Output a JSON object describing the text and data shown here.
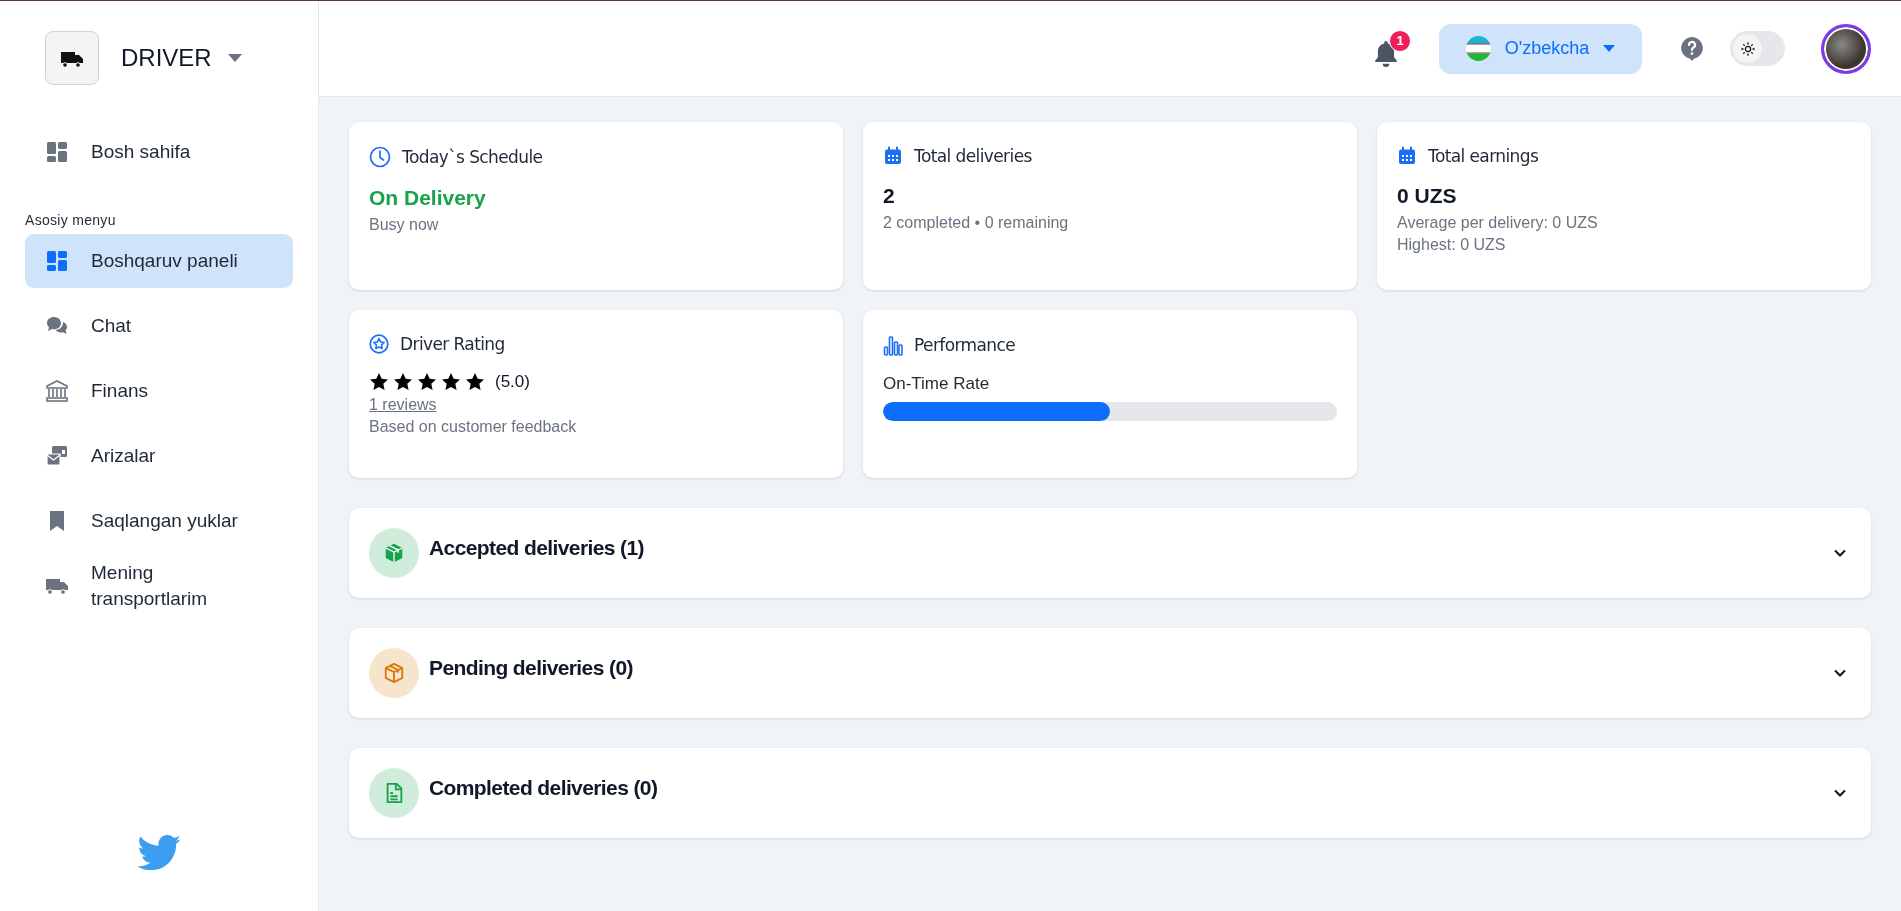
{
  "sidebar": {
    "brand": "DRIVER",
    "home": {
      "label": "Bosh sahifa",
      "selected": false
    },
    "section_label": "Asosiy menyu",
    "items": [
      {
        "kind": "dashboard",
        "label": "Boshqaruv paneli",
        "selected": true
      },
      {
        "kind": "chat",
        "label": "Chat",
        "selected": false
      },
      {
        "kind": "bank",
        "label": "Finans",
        "selected": false
      },
      {
        "kind": "mail",
        "label": "Arizalar",
        "selected": false
      },
      {
        "kind": "bookmark",
        "label": "Saqlangan yuklar",
        "selected": false
      },
      {
        "kind": "truck",
        "label": "Mening transportlarim",
        "selected": false
      }
    ]
  },
  "header": {
    "notification_count": "1",
    "language": "O'zbekcha",
    "theme_toggle": {
      "on": false
    }
  },
  "cards": {
    "schedule": {
      "title": "Today`s Schedule",
      "status": "On Delivery",
      "note": "Busy now"
    },
    "deliveries": {
      "title": "Total deliveries",
      "value": "2",
      "summary": "2 completed • 0 remaining"
    },
    "earnings": {
      "title": "Total earnings",
      "value": "0 UZS",
      "average": "Average per delivery: 0 UZS",
      "highest": "Highest: 0 UZS"
    },
    "rating": {
      "title": "Driver Rating",
      "stars": 5,
      "score": "(5.0)",
      "reviews_link": "1 reviews",
      "note": "Based on customer feedback"
    },
    "performance": {
      "title": "Performance",
      "metric": "On-Time Rate",
      "level": 0.5
    }
  },
  "sections": [
    {
      "kind": "accepted",
      "title": "Accepted deliveries (1)",
      "color": "#16a34a",
      "expanded": false
    },
    {
      "kind": "pending",
      "title": "Pending deliveries (0)",
      "color": "#d97706",
      "expanded": false
    },
    {
      "kind": "completed",
      "title": "Completed deliveries (0)",
      "color": "#16a34a",
      "expanded": false
    }
  ]
}
